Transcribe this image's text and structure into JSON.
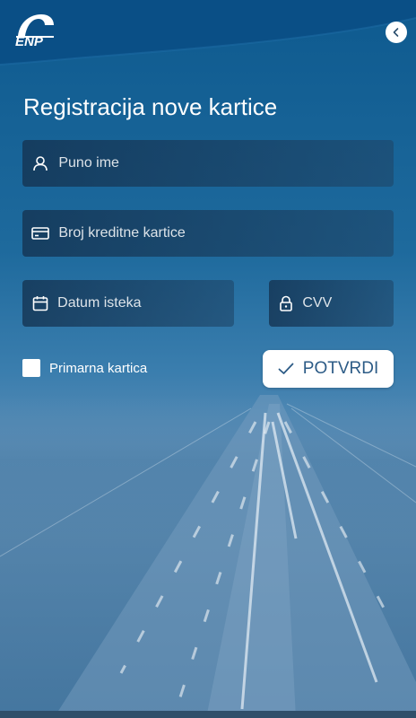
{
  "app": {
    "logo_text": "ENP"
  },
  "page": {
    "title": "Registracija nove kartice"
  },
  "form": {
    "full_name_placeholder": "Puno ime",
    "card_number_placeholder": "Broj kreditne kartice",
    "expiry_placeholder": "Datum isteka",
    "cvv_placeholder": "CVV",
    "primary_card_label": "Primarna kartica",
    "confirm_label": "POTVRDI"
  },
  "colors": {
    "brand": "#0e5a8f",
    "button_text": "#2c5b86"
  },
  "icons": [
    "back-arrow-icon",
    "user-icon",
    "credit-card-icon",
    "calendar-icon",
    "lock-icon",
    "check-icon"
  ]
}
